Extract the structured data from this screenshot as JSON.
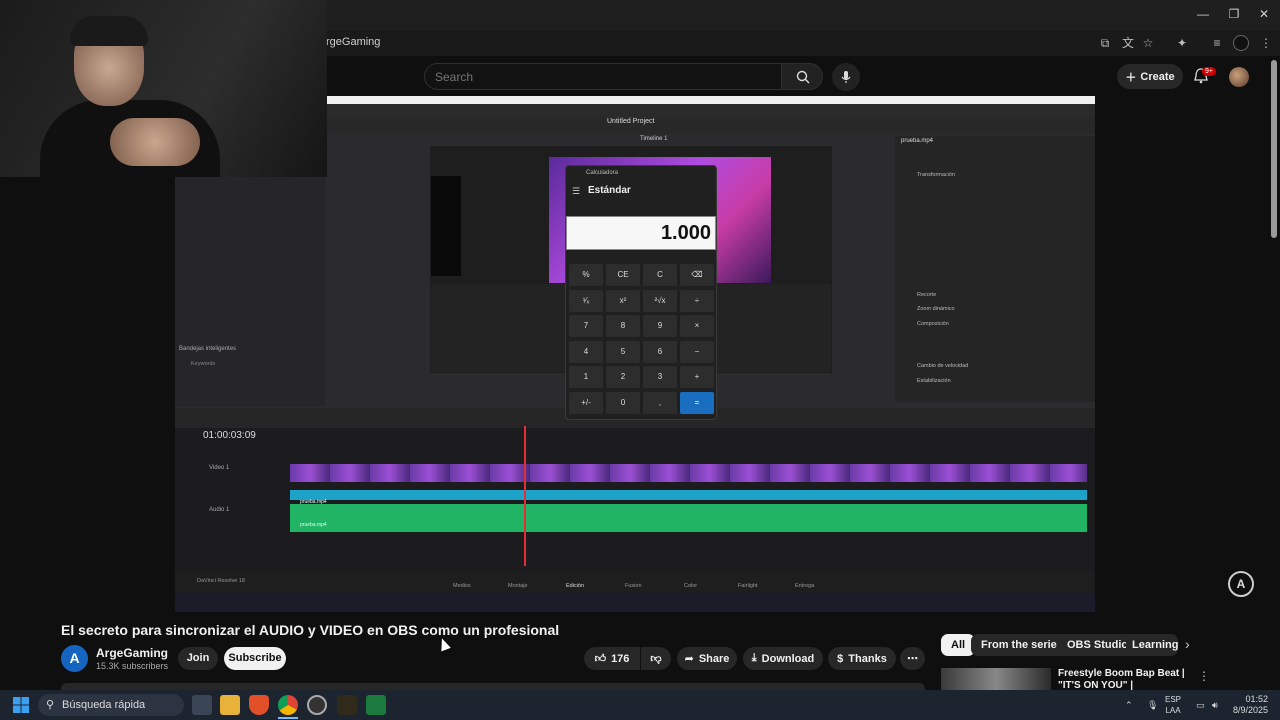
{
  "browser": {
    "address_text": "rgeGaming"
  },
  "youtube": {
    "search_placeholder": "Search",
    "create_label": "Create",
    "notification_badge": "9+"
  },
  "video_frame": {
    "resolve_project_title": "Untitled Project",
    "timeline_label": "Timeline 1",
    "timecode": "01:00:03:09",
    "inspector_file": "prueba.mp4",
    "inspector_sections": [
      "Transformación",
      "Recorte",
      "Zoom dinámico",
      "Composición",
      "Cambio de velocidad",
      "Estabilización"
    ],
    "track_video": "Video 1",
    "track_audio": "Audio 1",
    "clip_name_1": "prueba.mp4",
    "clip_name_2": "prueba.mp4",
    "media_label": "Bandejas inteligentes",
    "media_sub": "Keywords",
    "resolve_brand": "DaVinci Resolve 18",
    "page_tabs": [
      "Medios",
      "Montaje",
      "Edición",
      "Fusion",
      "Color",
      "Fairlight",
      "Entrega"
    ]
  },
  "calculator": {
    "title": "Calculadora",
    "mode": "Estándar",
    "display": "1.000",
    "keys": [
      [
        "%",
        "CE",
        "C",
        "⌫"
      ],
      [
        "¹⁄ₓ",
        "x²",
        "²√x",
        "÷"
      ],
      [
        "7",
        "8",
        "9",
        "×"
      ],
      [
        "4",
        "5",
        "6",
        "−"
      ],
      [
        "1",
        "2",
        "3",
        "+"
      ],
      [
        "+/-",
        "0",
        ",",
        "="
      ]
    ]
  },
  "video_info": {
    "title": "El secreto para sincronizar el AUDIO y VIDEO en OBS como un profesional",
    "channel_initial": "A",
    "channel_name": "ArgeGaming",
    "subscribers": "15.3K subscribers",
    "join_label": "Join",
    "subscribe_label": "Subscribe",
    "like_count": "176",
    "share_label": "Share",
    "download_label": "Download",
    "thanks_label": "Thanks",
    "more_label": "⋯"
  },
  "chips": [
    "All",
    "From the series",
    "OBS Studio",
    "Learning"
  ],
  "recommendation": {
    "title": "Freestyle Boom Bap Beat | \"IT'S ON YOU\" | Underground Boom"
  },
  "taskbar": {
    "search_text": "Búsqueda rápida",
    "lang_line1": "ESP",
    "lang_line2": "LAA",
    "time": "01:52",
    "date": "8/9/2025"
  },
  "colors": {
    "accent_red": "#cc0000",
    "youtube_bg": "#0f0f0f",
    "calc_equals": "#1a6ec0"
  }
}
